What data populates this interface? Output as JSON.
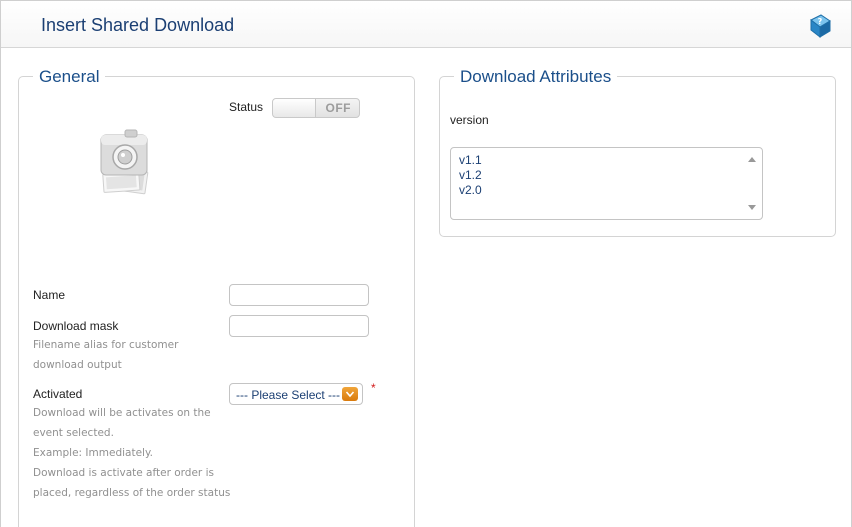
{
  "header": {
    "title": "Insert Shared Download",
    "help_icon": "help-book-icon"
  },
  "general": {
    "legend": "General",
    "status": {
      "label": "Status",
      "toggle_text": "OFF"
    },
    "image_icon": "camera-photo-icon",
    "name": {
      "label": "Name",
      "value": ""
    },
    "download_mask": {
      "label": "Download mask",
      "help": "Filename alias for customer download output",
      "value": ""
    },
    "activated": {
      "label": "Activated",
      "help": "Download will be activates on the event selected.",
      "example": "Example: Immediately.",
      "example_detail": "Download is activate after order is placed, regardless of the order status",
      "selected": "--- Please Select ---",
      "required_mark": "*"
    }
  },
  "attributes": {
    "legend": "Download Attributes",
    "version_label": "version",
    "versions": [
      "v1.1",
      "v1.2",
      "v2.0"
    ]
  },
  "colors": {
    "title": "#1b3f73",
    "legend": "#1b4f8a",
    "accent_orange": "#e08a1e",
    "required": "#d21c1c"
  }
}
